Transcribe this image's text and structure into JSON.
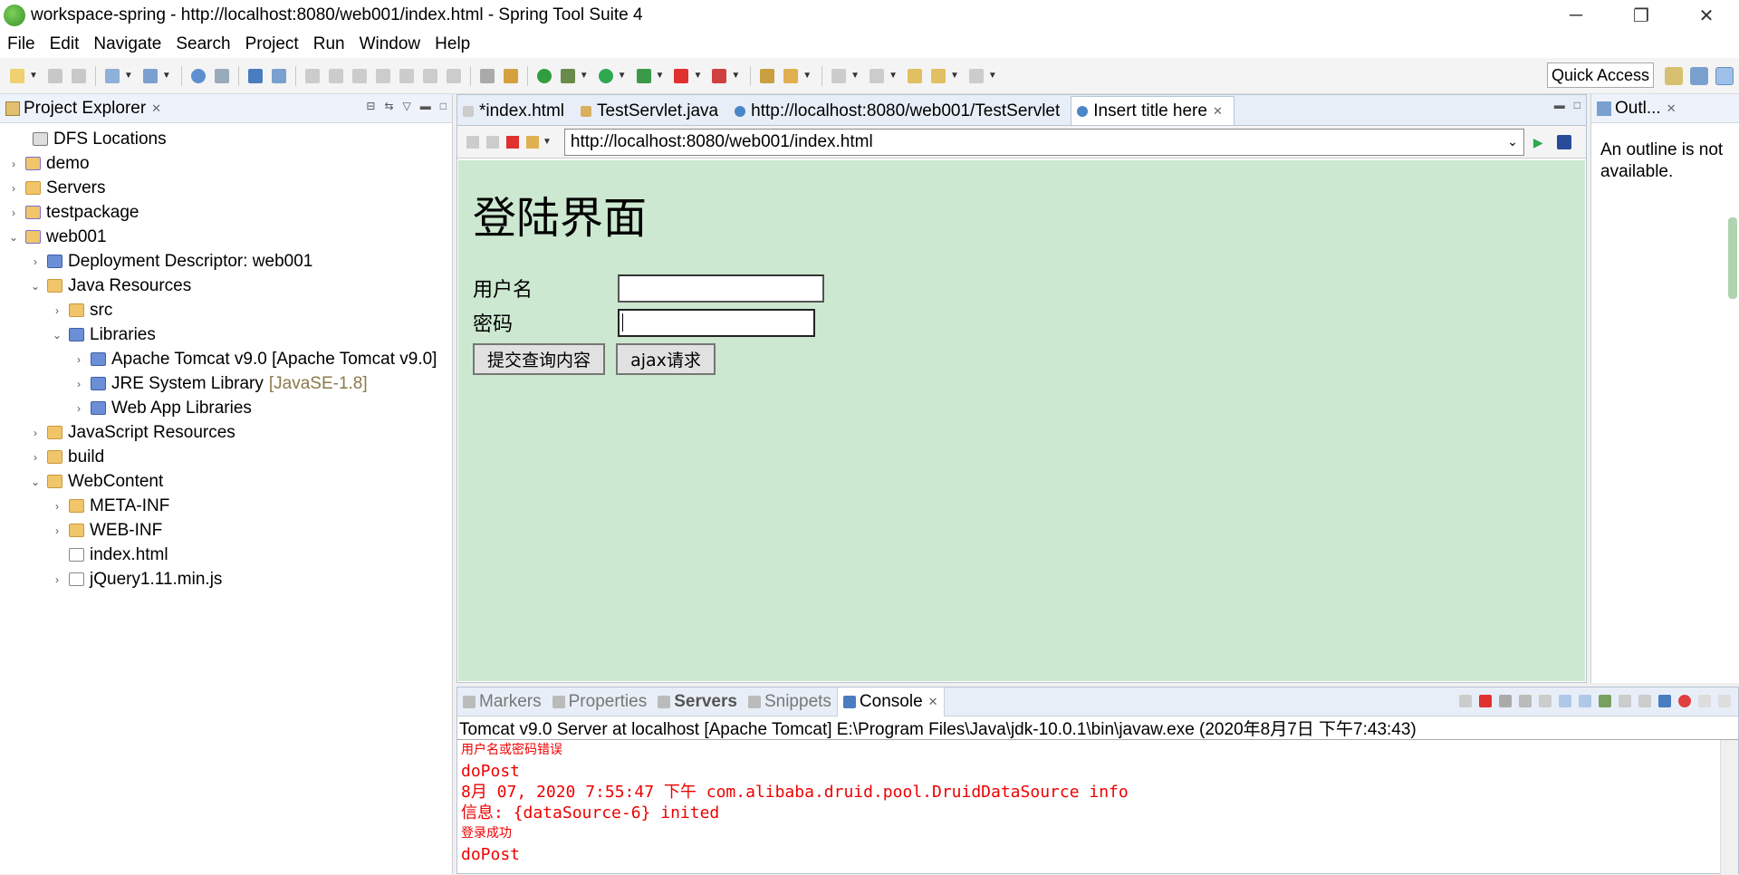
{
  "window": {
    "title": "workspace-spring - http://localhost:8080/web001/index.html - Spring Tool Suite 4",
    "minimize": "─",
    "restore": "❐",
    "close": "✕"
  },
  "menu": [
    "File",
    "Edit",
    "Navigate",
    "Search",
    "Project",
    "Run",
    "Window",
    "Help"
  ],
  "toolbar": {
    "quick_access": "Quick Access"
  },
  "explorer": {
    "title": "Project Explorer",
    "items": [
      {
        "label": "DFS Locations",
        "deco": ""
      },
      {
        "label": "demo",
        "deco": ""
      },
      {
        "label": "Servers",
        "deco": ""
      },
      {
        "label": "testpackage",
        "deco": ""
      },
      {
        "label": "web001",
        "deco": ""
      },
      {
        "label": "Deployment Descriptor: web001",
        "deco": ""
      },
      {
        "label": "Java Resources",
        "deco": ""
      },
      {
        "label": "src",
        "deco": ""
      },
      {
        "label": "Libraries",
        "deco": ""
      },
      {
        "label": "Apache Tomcat v9.0 [Apache Tomcat v9.0]",
        "deco": ""
      },
      {
        "label": "JRE System Library",
        "deco": "[JavaSE-1.8]"
      },
      {
        "label": "Web App Libraries",
        "deco": ""
      },
      {
        "label": "JavaScript Resources",
        "deco": ""
      },
      {
        "label": "build",
        "deco": ""
      },
      {
        "label": "WebContent",
        "deco": ""
      },
      {
        "label": "META-INF",
        "deco": ""
      },
      {
        "label": "WEB-INF",
        "deco": ""
      },
      {
        "label": "index.html",
        "deco": ""
      },
      {
        "label": "jQuery1.11.min.js",
        "deco": ""
      }
    ]
  },
  "editor": {
    "tabs": [
      "*index.html",
      "TestServlet.java",
      "http://localhost:8080/web001/TestServlet",
      "Insert title here"
    ],
    "url": "http://localhost:8080/web001/index.html",
    "page": {
      "heading": "登陆界面",
      "username_label": "用户名",
      "password_label": "密码",
      "submit_button": "提交查询内容",
      "ajax_button": "ajax请求"
    }
  },
  "outline": {
    "title": "Outl...",
    "message": "An outline is not available."
  },
  "console": {
    "tabs": [
      "Markers",
      "Properties",
      "Servers",
      "Snippets",
      "Console"
    ],
    "header": "Tomcat v9.0 Server at localhost [Apache Tomcat] E:\\Program Files\\Java\\jdk-10.0.1\\bin\\javaw.exe (2020年8月7日 下午7:43:43)",
    "lines": [
      "用户名或密码错误",
      "doPost",
      "8月 07, 2020 7:55:47 下午 com.alibaba.druid.pool.DruidDataSource info",
      "信息: {dataSource-6} inited",
      "登录成功",
      "doPost"
    ]
  }
}
